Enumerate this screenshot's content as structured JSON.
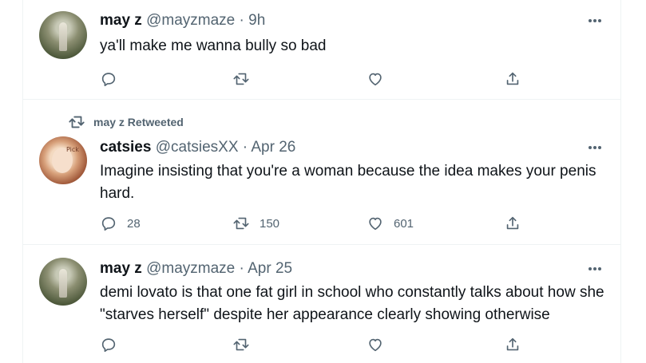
{
  "tweets": [
    {
      "name": "may z",
      "handle": "@mayzmaze",
      "sep": " · ",
      "time": "9h",
      "text": "ya'll make me wanna bully so bad",
      "avatar": "forest-figure-avatar",
      "replies": "",
      "retweets": "",
      "likes": ""
    },
    {
      "retweeted_by": "may z Retweeted",
      "name": "catsies",
      "handle": "@catsiesXX",
      "sep": " · ",
      "time": "Apr 26",
      "text": "Imagine insisting that you're a woman because the idea makes your penis hard.",
      "avatar": "painting-face-avatar",
      "avatar_mark": "Pick",
      "replies": "28",
      "retweets": "150",
      "likes": "601"
    },
    {
      "name": "may z",
      "handle": "@mayzmaze",
      "sep": " · ",
      "time": "Apr 25",
      "text": "demi lovato is that one fat girl in school who constantly talks about how she \"starves herself\" despite her appearance clearly showing otherwise",
      "avatar": "forest-figure-avatar",
      "replies": "",
      "retweets": "",
      "likes": ""
    }
  ],
  "colors": {
    "text": "#0f1419",
    "muted": "#536471",
    "border": "#eff3f4"
  },
  "icons": [
    "reply-icon",
    "retweet-icon",
    "like-icon",
    "share-icon",
    "more-icon"
  ]
}
